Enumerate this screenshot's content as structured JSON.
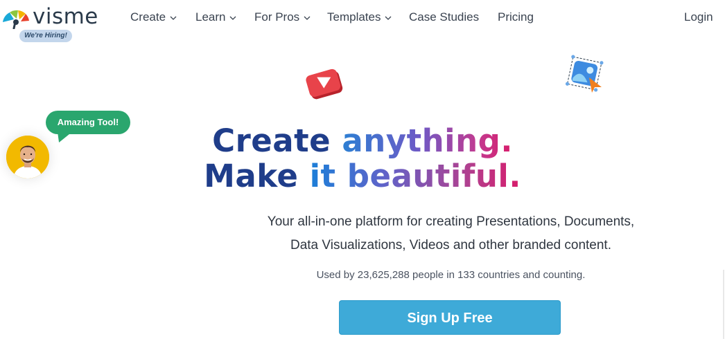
{
  "header": {
    "logo_text": "visme",
    "hiring_badge": "We're Hiring!",
    "nav": [
      {
        "label": "Create",
        "has_dropdown": true
      },
      {
        "label": "Learn",
        "has_dropdown": true
      },
      {
        "label": "For Pros",
        "has_dropdown": true
      },
      {
        "label": "Templates",
        "has_dropdown": true
      },
      {
        "label": "Case Studies",
        "has_dropdown": false
      },
      {
        "label": "Pricing",
        "has_dropdown": false
      }
    ],
    "login_label": "Login"
  },
  "testimonial": {
    "bubble_text": "Amazing Tool!"
  },
  "hero": {
    "line1_a": "Create",
    "line1_b": "anything.",
    "line2_a": "Make",
    "line2_b": "it beautiful.",
    "subtitle_line1": "Your all-in-one platform for creating Presentations, Documents,",
    "subtitle_line2": "Data Visualizations, Videos and other branded content.",
    "stats": "Used by 23,625,288 people in 133 countries and counting.",
    "cta_label": "Sign Up Free"
  },
  "colors": {
    "navy": "#1f3d8a",
    "cta": "#3eaad8",
    "bubble": "#2aa66e",
    "avatar_bg": "#f2b900"
  },
  "icons": [
    "logo-mark-icon",
    "chevron-down-icon",
    "play-icon",
    "image-icon",
    "cursor-icon",
    "avatar"
  ]
}
